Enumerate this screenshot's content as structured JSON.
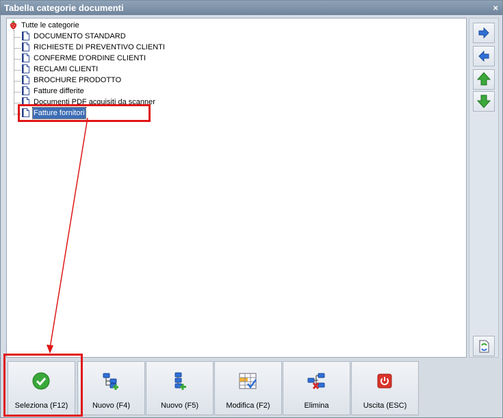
{
  "window": {
    "title": "Tabella categorie documenti",
    "close_glyph": "×"
  },
  "tree": {
    "root": {
      "label": "Tutte le categorie",
      "icon": "strawberry-icon"
    },
    "items": [
      {
        "label": "DOCUMENTO STANDARD",
        "icon": "document-icon"
      },
      {
        "label": "RICHIESTE DI PREVENTIVO CLIENTI",
        "icon": "document-icon"
      },
      {
        "label": "CONFERME D'ORDINE CLIENTI",
        "icon": "document-icon"
      },
      {
        "label": "RECLAMI CLIENTI",
        "icon": "document-icon"
      },
      {
        "label": "BROCHURE PRODOTTO",
        "icon": "document-icon"
      },
      {
        "label": "Fatture differite",
        "icon": "document-icon"
      },
      {
        "label": "Documenti PDF acquisiti da scanner",
        "icon": "document-icon"
      },
      {
        "label": "Fatture fornitori",
        "icon": "document-icon",
        "selected": true
      }
    ]
  },
  "sidebar": {
    "buttons": [
      "arrow-right-icon",
      "arrow-left-icon",
      "arrow-up-icon",
      "arrow-down-icon",
      "refresh-document-icon"
    ]
  },
  "toolbar": {
    "buttons": [
      {
        "label": "Seleziona (F12)",
        "icon": "check-icon"
      },
      {
        "label": "Nuovo (F4)",
        "icon": "new-node-icon"
      },
      {
        "label": "Nuovo (F5)",
        "icon": "new-child-icon"
      },
      {
        "label": "Modifica (F2)",
        "icon": "edit-grid-icon"
      },
      {
        "label": "Elimina",
        "icon": "delete-node-icon"
      },
      {
        "label": "Uscita (ESC)",
        "icon": "power-icon"
      }
    ]
  },
  "colors": {
    "highlight": "#e01515",
    "selection": "#3d6db5",
    "arrow_blue": "#2f6fd6",
    "arrow_green": "#3aa83a"
  }
}
